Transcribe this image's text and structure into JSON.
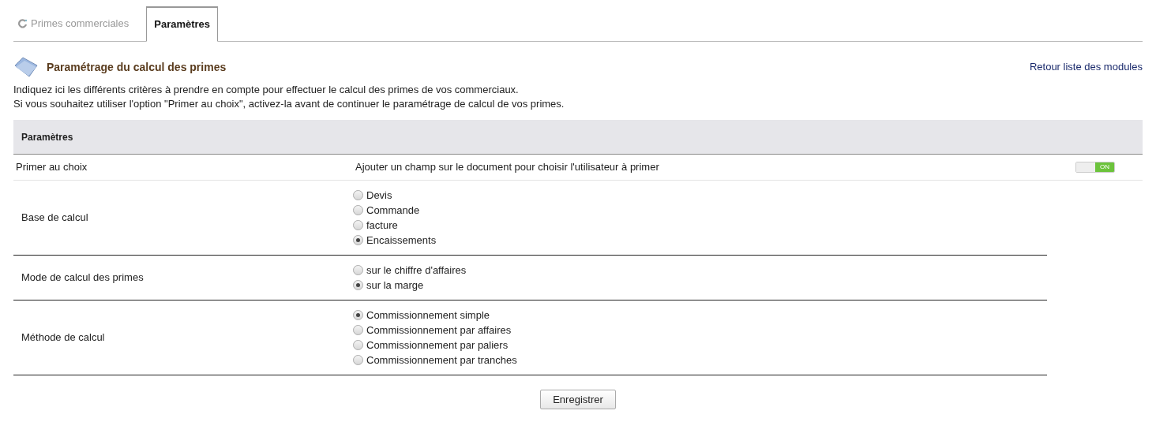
{
  "tabs": [
    {
      "label": "Primes commerciales",
      "selected": false
    },
    {
      "label": "Paramètres",
      "selected": true
    }
  ],
  "header": {
    "title": "Paramétrage du calcul des primes",
    "link": "Retour liste des modules"
  },
  "description": [
    "Indiquez ici les différents critères à prendre en compte pour effectuer le calcul des primes de vos commerciaux.",
    "Si vous souhaitez utiliser l'option \"Primer au choix\", activez-la avant de continuer le paramétrage de calcul de vos primes."
  ],
  "section": {
    "title": "Paramètres"
  },
  "toggle_row": {
    "label": "Primer au choix",
    "description": "Ajouter un champ sur le document pour choisir l'utilisateur à primer",
    "on": true,
    "state_label": "ON"
  },
  "groups": [
    {
      "label": "Base de calcul",
      "options": [
        {
          "label": "Devis",
          "selected": false
        },
        {
          "label": "Commande",
          "selected": false
        },
        {
          "label": "facture",
          "selected": false
        },
        {
          "label": "Encaissements",
          "selected": true
        }
      ]
    },
    {
      "label": "Mode de calcul des primes",
      "options": [
        {
          "label": "sur le chiffre d'affaires",
          "selected": false
        },
        {
          "label": "sur la marge",
          "selected": true
        }
      ]
    },
    {
      "label": "Méthode de calcul",
      "options": [
        {
          "label": "Commissionnement simple",
          "selected": true
        },
        {
          "label": "Commissionnement par affaires",
          "selected": false
        },
        {
          "label": "Commissionnement par paliers",
          "selected": false
        },
        {
          "label": "Commissionnement par tranches",
          "selected": false
        }
      ]
    }
  ],
  "save_button": "Enregistrer"
}
